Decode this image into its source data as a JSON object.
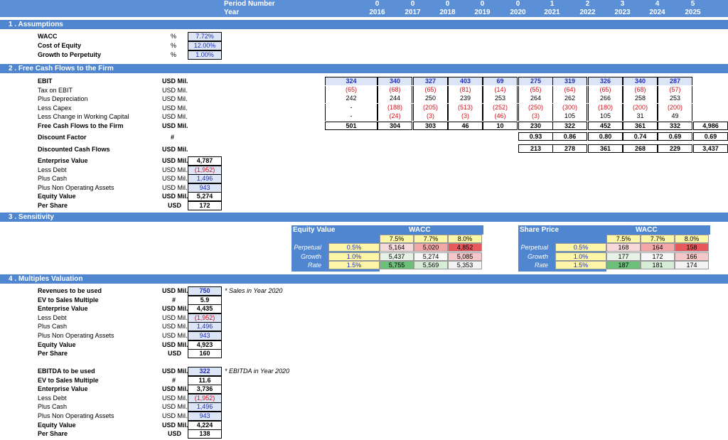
{
  "header": {
    "period_label": "Period Number",
    "year_label": "Year",
    "periods": [
      "0",
      "0",
      "0",
      "0",
      "0",
      "1",
      "2",
      "3",
      "4",
      "5"
    ],
    "years": [
      "2016",
      "2017",
      "2018",
      "2019",
      "2020",
      "2021",
      "2022",
      "2023",
      "2024",
      "2025"
    ]
  },
  "sections": {
    "s1": "1 . Assumptions",
    "s2": "2 . Free Cash Flows to the Firm",
    "s3": "3 . Sensitivity",
    "s4": "4 . Multiples Valuation"
  },
  "assumptions": [
    {
      "label": "WACC",
      "unit": "%",
      "value": "7.72%"
    },
    {
      "label": "Cost of Equity",
      "unit": "%",
      "value": "12.00%"
    },
    {
      "label": "Growth to Perpetuity",
      "unit": "%",
      "value": "1.00%"
    }
  ],
  "fcf": {
    "rows": [
      {
        "label": "EBIT",
        "unit": "USD Mil.",
        "bold": true,
        "values": [
          "324",
          "340",
          "327",
          "403",
          "69",
          "275",
          "319",
          "326",
          "340",
          "287"
        ],
        "style": "inp"
      },
      {
        "label": "Tax on EBIT",
        "unit": "USD Mil.",
        "bold": false,
        "values": [
          "(65)",
          "(68)",
          "(65)",
          "(81)",
          "(14)",
          "(55)",
          "(64)",
          "(65)",
          "(68)",
          "(57)"
        ],
        "style": "red"
      },
      {
        "label": "Plus Depreciation",
        "unit": "USD Mil.",
        "bold": false,
        "values": [
          "242",
          "244",
          "250",
          "239",
          "253",
          "264",
          "262",
          "266",
          "258",
          "253"
        ],
        "style": ""
      },
      {
        "label": "Less Capex",
        "unit": "USD Mil.",
        "bold": false,
        "values": [
          "-",
          "(188)",
          "(205)",
          "(513)",
          "(252)",
          "(250)",
          "(300)",
          "(180)",
          "(200)",
          "(200)"
        ],
        "style": "red"
      },
      {
        "label": "Less Change in Working Capital",
        "unit": "USD Mil.",
        "bold": false,
        "values": [
          "-",
          "(24)",
          "(3)",
          "(3)",
          "(46)",
          "(3)",
          "105",
          "105",
          "31",
          "49"
        ],
        "style": "red"
      },
      {
        "label": "Free Cash Flows to the Firm",
        "unit": "USD Mil.",
        "bold": true,
        "values": [
          "501",
          "304",
          "303",
          "46",
          "10",
          "230",
          "322",
          "452",
          "361",
          "332",
          "4,986"
        ],
        "style": ""
      }
    ],
    "discount_label": "Discount Factor",
    "discount_unit": "#",
    "discount_values": [
      "0.93",
      "0.86",
      "0.80",
      "0.74",
      "0.69",
      "0.69"
    ],
    "dcf_label": "Discounted Cash Flows",
    "dcf_unit": "USD Mil.",
    "dcf_values": [
      "213",
      "278",
      "361",
      "268",
      "229",
      "3,437"
    ]
  },
  "valuation": [
    {
      "label": "Enterprise Value",
      "unit": "USD Mil.",
      "value": "4,787",
      "bold": true,
      "style": ""
    },
    {
      "label": "Less Debt",
      "unit": "USD Mil.",
      "value": "(1,952)",
      "bold": false,
      "style": "inp red"
    },
    {
      "label": "Plus Cash",
      "unit": "USD Mil.",
      "value": "1,496",
      "bold": false,
      "style": "inp"
    },
    {
      "label": "Plus Non Operating Assets",
      "unit": "USD Mil.",
      "value": "943",
      "bold": false,
      "style": "inp"
    },
    {
      "label": "Equity Value",
      "unit": "USD Mil.",
      "value": "5,274",
      "bold": true,
      "style": ""
    },
    {
      "label": "Per Share",
      "unit": "USD",
      "value": "172",
      "bold": true,
      "style": ""
    }
  ],
  "sensitivity": {
    "equity": {
      "title": "Equity Value",
      "wacc": "WACC",
      "cols": [
        "7.5%",
        "7.7%",
        "8.0%"
      ],
      "row_labels": [
        "Perpetual",
        "Growth",
        "Rate"
      ],
      "rates": [
        "0.5%",
        "1.0%",
        "1.5%"
      ],
      "values": [
        [
          "5,164",
          "5,020",
          "4,852"
        ],
        [
          "5,437",
          "5,274",
          "5,085"
        ],
        [
          "5,755",
          "5,569",
          "5,353"
        ]
      ],
      "colors": [
        [
          "#f8d9da",
          "#f4a7a9",
          "#e8595e"
        ],
        [
          "#e6f2e6",
          "#f8f8f8",
          "#f4c8c9"
        ],
        [
          "#6cc07a",
          "#d6ecd7",
          "#f3f3f3"
        ]
      ]
    },
    "share": {
      "title": "Share Price",
      "wacc": "WACC",
      "cols": [
        "7.5%",
        "7.7%",
        "8.0%"
      ],
      "row_labels": [
        "Perpetual",
        "Growth",
        "Rate"
      ],
      "rates": [
        "0.5%",
        "1.0%",
        "1.5%"
      ],
      "values": [
        [
          "168",
          "164",
          "158"
        ],
        [
          "177",
          "172",
          "166"
        ],
        [
          "187",
          "181",
          "174"
        ]
      ],
      "colors": [
        [
          "#f8d9da",
          "#f4a7a9",
          "#e8595e"
        ],
        [
          "#e6f2e6",
          "#f8f8f8",
          "#f4c8c9"
        ],
        [
          "#6cc07a",
          "#d6ecd7",
          "#f3f3f3"
        ]
      ]
    }
  },
  "multiples": {
    "sales": [
      {
        "label": "Revenues to be used",
        "unit": "USD Mil.",
        "value": "750",
        "bold": true,
        "style": "inp"
      },
      {
        "label": "EV to Sales Multiple",
        "unit": "#",
        "value": "5.9",
        "bold": true,
        "style": ""
      },
      {
        "label": "Enterprise Value",
        "unit": "USD Mil.",
        "value": "4,435",
        "bold": true,
        "style": ""
      },
      {
        "label": "Less Debt",
        "unit": "USD Mil.",
        "value": "(1,952)",
        "bold": false,
        "style": "inp red"
      },
      {
        "label": "Plus Cash",
        "unit": "USD Mil.",
        "value": "1,496",
        "bold": false,
        "style": "inp"
      },
      {
        "label": "Plus Non Operating Assets",
        "unit": "USD Mil.",
        "value": "943",
        "bold": false,
        "style": "inp"
      },
      {
        "label": "Equity Value",
        "unit": "USD Mil.",
        "value": "4,923",
        "bold": true,
        "style": ""
      },
      {
        "label": "Per Share",
        "unit": "USD",
        "value": "160",
        "bold": true,
        "style": ""
      }
    ],
    "sales_note": "* Sales in Year 2020",
    "ebitda": [
      {
        "label": "EBITDA to be used",
        "unit": "USD Mil.",
        "value": "322",
        "bold": true,
        "style": "inp"
      },
      {
        "label": "EV to Sales Multiple",
        "unit": "#",
        "value": "11.6",
        "bold": true,
        "style": ""
      },
      {
        "label": "Enterprise Value",
        "unit": "USD Mil.",
        "value": "3,736",
        "bold": true,
        "style": ""
      },
      {
        "label": "Less Debt",
        "unit": "USD Mil.",
        "value": "(1,952)",
        "bold": false,
        "style": "inp red"
      },
      {
        "label": "Plus Cash",
        "unit": "USD Mil.",
        "value": "1,496",
        "bold": false,
        "style": "inp"
      },
      {
        "label": "Plus Non Operating Assets",
        "unit": "USD Mil.",
        "value": "943",
        "bold": false,
        "style": "inp"
      },
      {
        "label": "Equity Value",
        "unit": "USD Mil.",
        "value": "4,224",
        "bold": true,
        "style": ""
      },
      {
        "label": "Per Share",
        "unit": "USD",
        "value": "138",
        "bold": true,
        "style": ""
      }
    ],
    "ebitda_note": "* EBITDA in Year 2020"
  }
}
